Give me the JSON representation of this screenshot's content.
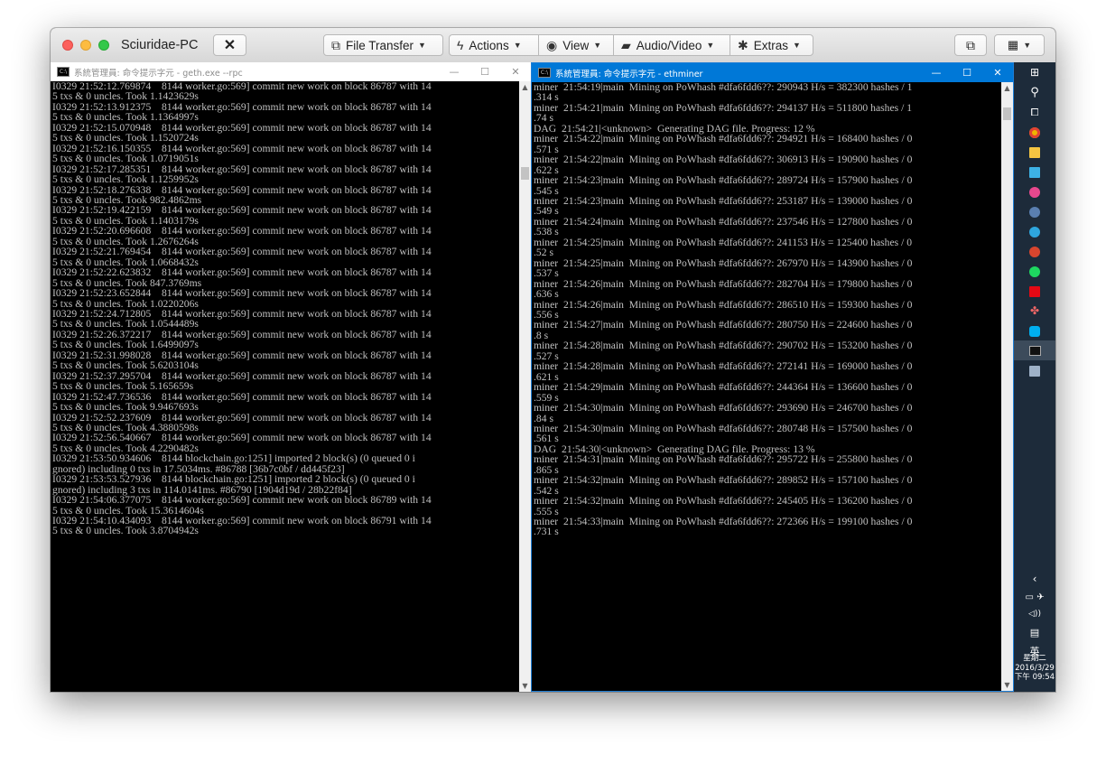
{
  "window": {
    "title": "Sciuridae-PC",
    "close_label": "✕"
  },
  "toolbar": {
    "file_transfer": "File Transfer",
    "actions": "Actions",
    "view": "View",
    "audio_video": "Audio/Video",
    "extras": "Extras"
  },
  "left_console": {
    "title": "系統管理員: 命令提示字元 - geth.exe --rpc",
    "text": "I0329 21:52:12.769874    8144 worker.go:569] commit new work on block 86787 with 14\n5 txs & 0 uncles. Took 1.1423629s\nI0329 21:52:13.912375    8144 worker.go:569] commit new work on block 86787 with 14\n5 txs & 0 uncles. Took 1.1364997s\nI0329 21:52:15.070948    8144 worker.go:569] commit new work on block 86787 with 14\n5 txs & 0 uncles. Took 1.1520724s\nI0329 21:52:16.150355    8144 worker.go:569] commit new work on block 86787 with 14\n5 txs & 0 uncles. Took 1.0719051s\nI0329 21:52:17.285351    8144 worker.go:569] commit new work on block 86787 with 14\n5 txs & 0 uncles. Took 1.1259952s\nI0329 21:52:18.276338    8144 worker.go:569] commit new work on block 86787 with 14\n5 txs & 0 uncles. Took 982.4862ms\nI0329 21:52:19.422159    8144 worker.go:569] commit new work on block 86787 with 14\n5 txs & 0 uncles. Took 1.1403179s\nI0329 21:52:20.696608    8144 worker.go:569] commit new work on block 86787 with 14\n5 txs & 0 uncles. Took 1.2676264s\nI0329 21:52:21.769454    8144 worker.go:569] commit new work on block 86787 with 14\n5 txs & 0 uncles. Took 1.0668432s\nI0329 21:52:22.623832    8144 worker.go:569] commit new work on block 86787 with 14\n5 txs & 0 uncles. Took 847.3769ms\nI0329 21:52:23.652844    8144 worker.go:569] commit new work on block 86787 with 14\n5 txs & 0 uncles. Took 1.0220206s\nI0329 21:52:24.712805    8144 worker.go:569] commit new work on block 86787 with 14\n5 txs & 0 uncles. Took 1.0544489s\nI0329 21:52:26.372217    8144 worker.go:569] commit new work on block 86787 with 14\n5 txs & 0 uncles. Took 1.6499097s\nI0329 21:52:31.998028    8144 worker.go:569] commit new work on block 86787 with 14\n5 txs & 0 uncles. Took 5.6203104s\nI0329 21:52:37.295704    8144 worker.go:569] commit new work on block 86787 with 14\n5 txs & 0 uncles. Took 5.165659s\nI0329 21:52:47.736536    8144 worker.go:569] commit new work on block 86787 with 14\n5 txs & 0 uncles. Took 9.9467693s\nI0329 21:52:52.237609    8144 worker.go:569] commit new work on block 86787 with 14\n5 txs & 0 uncles. Took 4.3880598s\nI0329 21:52:56.540667    8144 worker.go:569] commit new work on block 86787 with 14\n5 txs & 0 uncles. Took 4.2290482s\nI0329 21:53:50.934606    8144 blockchain.go:1251] imported 2 block(s) (0 queued 0 i\ngnored) including 0 txs in 17.5034ms. #86788 [36b7c0bf / dd445f23]\nI0329 21:53:53.527936    8144 blockchain.go:1251] imported 2 block(s) (0 queued 0 i\ngnored) including 3 txs in 114.0141ms. #86790 [1904d19d / 28b22f84]\nI0329 21:54:06.377075    8144 worker.go:569] commit new work on block 86789 with 14\n5 txs & 0 uncles. Took 15.3614604s\nI0329 21:54:10.434093    8144 worker.go:569] commit new work on block 86791 with 14\n5 txs & 0 uncles. Took 3.8704942s"
  },
  "right_console": {
    "title": "系統管理員: 命令提示字元 - ethminer",
    "text": "miner  21:54:19|main  Mining on PoWhash #dfa6fdd6??: 290943 H/s = 382300 hashes / 1\n.314 s\nminer  21:54:21|main  Mining on PoWhash #dfa6fdd6??: 294137 H/s = 511800 hashes / 1\n.74 s\nDAG  21:54:21|<unknown>  Generating DAG file. Progress: 12 %\nminer  21:54:22|main  Mining on PoWhash #dfa6fdd6??: 294921 H/s = 168400 hashes / 0\n.571 s\nminer  21:54:22|main  Mining on PoWhash #dfa6fdd6??: 306913 H/s = 190900 hashes / 0\n.622 s\nminer  21:54:23|main  Mining on PoWhash #dfa6fdd6??: 289724 H/s = 157900 hashes / 0\n.545 s\nminer  21:54:23|main  Mining on PoWhash #dfa6fdd6??: 253187 H/s = 139000 hashes / 0\n.549 s\nminer  21:54:24|main  Mining on PoWhash #dfa6fdd6??: 237546 H/s = 127800 hashes / 0\n.538 s\nminer  21:54:25|main  Mining on PoWhash #dfa6fdd6??: 241153 H/s = 125400 hashes / 0\n.52 s\nminer  21:54:25|main  Mining on PoWhash #dfa6fdd6??: 267970 H/s = 143900 hashes / 0\n.537 s\nminer  21:54:26|main  Mining on PoWhash #dfa6fdd6??: 282704 H/s = 179800 hashes / 0\n.636 s\nminer  21:54:26|main  Mining on PoWhash #dfa6fdd6??: 286510 H/s = 159300 hashes / 0\n.556 s\nminer  21:54:27|main  Mining on PoWhash #dfa6fdd6??: 280750 H/s = 224600 hashes / 0\n.8 s\nminer  21:54:28|main  Mining on PoWhash #dfa6fdd6??: 290702 H/s = 153200 hashes / 0\n.527 s\nminer  21:54:28|main  Mining on PoWhash #dfa6fdd6??: 272141 H/s = 169000 hashes / 0\n.621 s\nminer  21:54:29|main  Mining on PoWhash #dfa6fdd6??: 244364 H/s = 136600 hashes / 0\n.559 s\nminer  21:54:30|main  Mining on PoWhash #dfa6fdd6??: 293690 H/s = 246700 hashes / 0\n.84 s\nminer  21:54:30|main  Mining on PoWhash #dfa6fdd6??: 280748 H/s = 157500 hashes / 0\n.561 s\nDAG  21:54:30|<unknown>  Generating DAG file. Progress: 13 %\nminer  21:54:31|main  Mining on PoWhash #dfa6fdd6??: 295722 H/s = 255800 hashes / 0\n.865 s\nminer  21:54:32|main  Mining on PoWhash #dfa6fdd6??: 289852 H/s = 157100 hashes / 0\n.542 s\nminer  21:54:32|main  Mining on PoWhash #dfa6fdd6??: 245405 H/s = 136200 hashes / 0\n.555 s\nminer  21:54:33|main  Mining on PoWhash #dfa6fdd6??: 272366 H/s = 199100 hashes / 0\n.731 s"
  },
  "taskbar": {
    "ime": "英",
    "time": "下午 09:54",
    "weekday": "星期二",
    "date": "2016/3/29"
  },
  "colors": {
    "console_bg": "#000000",
    "console_text": "#c0c0c0",
    "active_title": "#0078d7",
    "taskbar": "#1d2b3a"
  }
}
